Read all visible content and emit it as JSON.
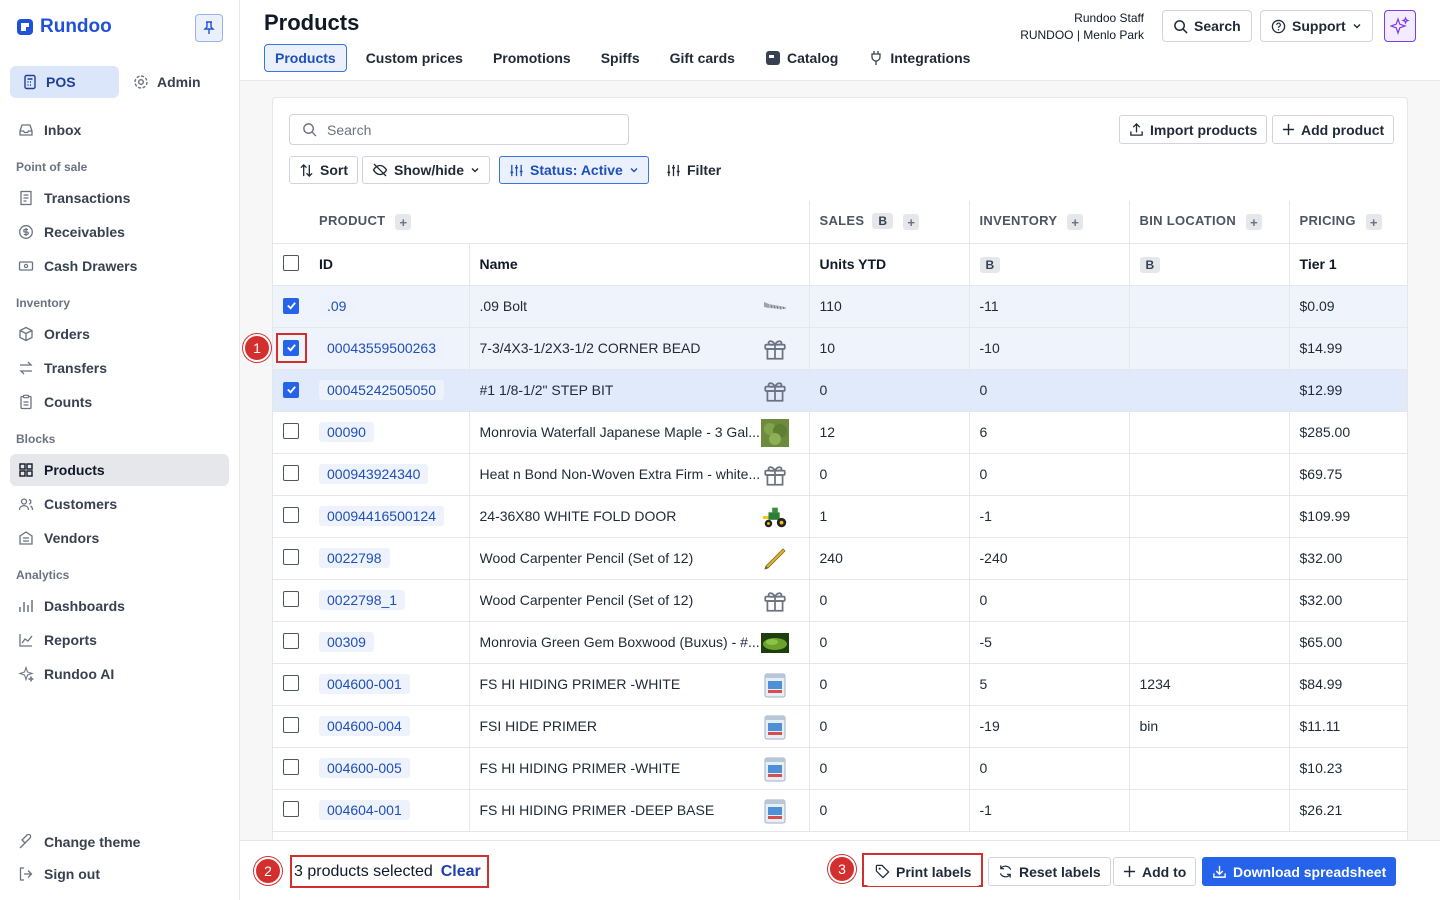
{
  "app": {
    "name": "Rundoo"
  },
  "sidebar": {
    "modes": [
      {
        "label": "POS"
      },
      {
        "label": "Admin"
      }
    ],
    "inbox": "Inbox",
    "sections": {
      "point_of_sale": "Point of sale",
      "inventory": "Inventory",
      "blocks": "Blocks",
      "analytics": "Analytics"
    },
    "items": {
      "transactions": "Transactions",
      "receivables": "Receivables",
      "cash_drawers": "Cash Drawers",
      "orders": "Orders",
      "transfers": "Transfers",
      "counts": "Counts",
      "products": "Products",
      "customers": "Customers",
      "vendors": "Vendors",
      "dashboards": "Dashboards",
      "reports": "Reports",
      "rundoo_ai": "Rundoo AI"
    },
    "footer": {
      "change_theme": "Change theme",
      "sign_out": "Sign out"
    }
  },
  "header": {
    "title": "Products",
    "tabs": [
      "Products",
      "Custom prices",
      "Promotions",
      "Spiffs",
      "Gift cards",
      "Catalog",
      "Integrations"
    ],
    "staff_name": "Rundoo Staff",
    "store": "RUNDOO | Menlo Park",
    "search_label": "Search",
    "support_label": "Support"
  },
  "toolbar": {
    "search_placeholder": "Search",
    "import_label": "Import products",
    "add_label": "Add product",
    "sort_label": "Sort",
    "showhide_label": "Show/hide",
    "status_label": "Status: Active",
    "filter_label": "Filter"
  },
  "table": {
    "groups": {
      "product": "PRODUCT",
      "sales": "SALES",
      "inventory": "INVENTORY",
      "bin": "BIN LOCATION",
      "pricing": "PRICING"
    },
    "chip": "B",
    "columns": {
      "id": "ID",
      "name": "Name",
      "units": "Units YTD",
      "tier": "Tier 1"
    },
    "rows": [
      {
        "checked": true,
        "id": ".09",
        "name": ".09 Bolt",
        "thumb": "bolt",
        "units": "110",
        "inventory": "-11",
        "bin": "",
        "price": "$0.09"
      },
      {
        "checked": true,
        "id": "00043559500263",
        "name": "7-3/4X3-1/2X3-1/2 CORNER BEAD",
        "thumb": "gift",
        "units": "10",
        "inventory": "-10",
        "bin": "",
        "price": "$14.99"
      },
      {
        "checked": true,
        "id": "00045242505050",
        "name": "#1 1/8-1/2\" STEP BIT",
        "thumb": "gift",
        "units": "0",
        "inventory": "0",
        "bin": "",
        "price": "$12.99"
      },
      {
        "checked": false,
        "id": "00090",
        "name": "Monrovia Waterfall Japanese Maple - 3 Gal...",
        "thumb": "plant",
        "units": "12",
        "inventory": "6",
        "bin": "",
        "price": "$285.00"
      },
      {
        "checked": false,
        "id": "000943924340",
        "name": "Heat n Bond Non-Woven Extra Firm - white...",
        "thumb": "gift",
        "units": "0",
        "inventory": "0",
        "bin": "",
        "price": "$69.75"
      },
      {
        "checked": false,
        "id": "00094416500124",
        "name": "24-36X80 WHITE FOLD DOOR",
        "thumb": "tractor",
        "units": "1",
        "inventory": "-1",
        "bin": "",
        "price": "$109.99"
      },
      {
        "checked": false,
        "id": "0022798",
        "name": "Wood Carpenter Pencil (Set of 12)",
        "thumb": "pencil",
        "units": "240",
        "inventory": "-240",
        "bin": "",
        "price": "$32.00"
      },
      {
        "checked": false,
        "id": "0022798_1",
        "name": "Wood Carpenter Pencil (Set of 12)",
        "thumb": "gift",
        "units": "0",
        "inventory": "0",
        "bin": "",
        "price": "$32.00"
      },
      {
        "checked": false,
        "id": "00309",
        "name": "Monrovia Green Gem Boxwood (Buxus) - #...",
        "thumb": "hedge",
        "units": "0",
        "inventory": "-5",
        "bin": "",
        "price": "$65.00"
      },
      {
        "checked": false,
        "id": "004600-001",
        "name": "FS HI HIDING PRIMER -WHITE",
        "thumb": "paint",
        "units": "0",
        "inventory": "5",
        "bin": "1234",
        "price": "$84.99"
      },
      {
        "checked": false,
        "id": "004600-004",
        "name": "FSI HIDE PRIMER",
        "thumb": "paint",
        "units": "0",
        "inventory": "-19",
        "bin": "bin",
        "price": "$11.11"
      },
      {
        "checked": false,
        "id": "004600-005",
        "name": "FS HI HIDING PRIMER -WHITE",
        "thumb": "paint",
        "units": "0",
        "inventory": "0",
        "bin": "",
        "price": "$10.23"
      },
      {
        "checked": false,
        "id": "004604-001",
        "name": "FS HI HIDING PRIMER -DEEP BASE",
        "thumb": "paint",
        "units": "0",
        "inventory": "-1",
        "bin": "",
        "price": "$26.21"
      }
    ]
  },
  "bottom_bar": {
    "selected_text": "3 products selected",
    "clear_label": "Clear",
    "print_labels": "Print labels",
    "reset_labels": "Reset labels",
    "add_to": "Add to",
    "download": "Download spreadsheet"
  },
  "annotations": [
    "1",
    "2",
    "3"
  ],
  "colors": {
    "accent": "#2563eb",
    "annotation": "#d32f2f",
    "ai": "#7c3aed"
  }
}
